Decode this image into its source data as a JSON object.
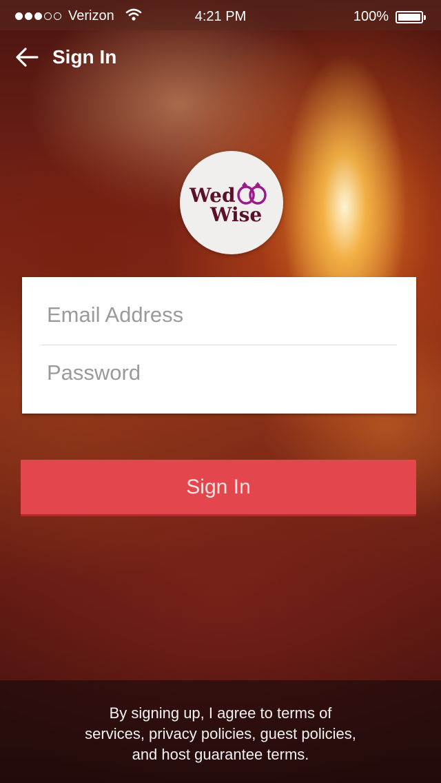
{
  "status_bar": {
    "carrier": "Verizon",
    "time": "4:21 PM",
    "battery": "100%",
    "signal_bars_filled": 3,
    "signal_bars_total": 5
  },
  "header": {
    "title": "Sign In"
  },
  "logo": {
    "line1": "Wed",
    "line2": "Wise"
  },
  "form": {
    "email_placeholder": "Email Address",
    "email_value": "",
    "password_placeholder": "Password",
    "password_value": ""
  },
  "signin_button": {
    "label": "Sign In"
  },
  "footer": {
    "lines": [
      "By signing up, I agree to  terms of",
      "services, privacy policies, guest policies,",
      "and host guarantee terms."
    ]
  },
  "colors": {
    "accent": "#e3474d",
    "logo_text": "#5a0f2a",
    "logo_rings": "#9b1a8c"
  },
  "icons": {
    "back": "back-arrow-icon",
    "wifi": "wifi-icon",
    "battery": "battery-icon",
    "logo_rings": "rings-icon"
  }
}
